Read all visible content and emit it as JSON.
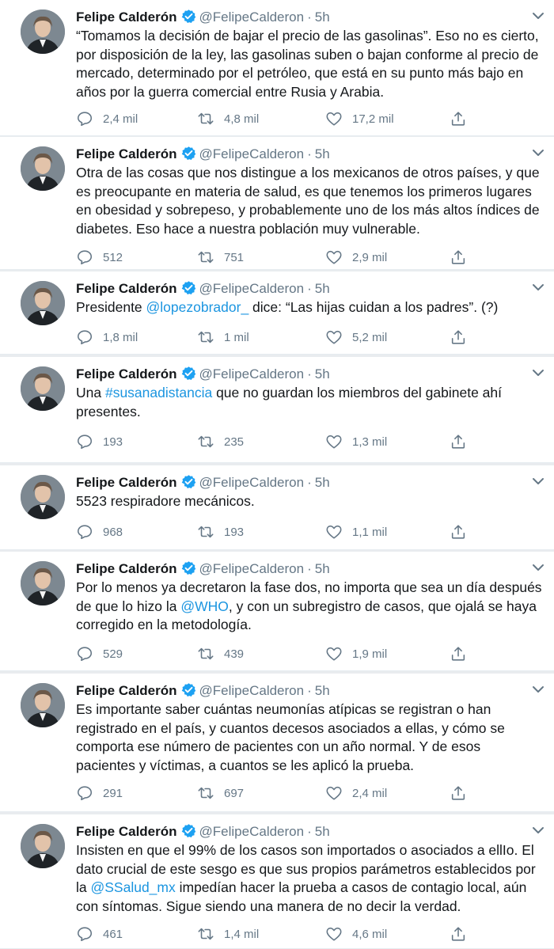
{
  "tweets": [
    {
      "name": "Felipe Calderón",
      "handle": "@FelipeCalderon",
      "time": "5h",
      "text": [
        {
          "t": "“Tomamos la decisión de bajar el precio de las gasolinas”. Eso no es cierto, por disposición de la ley, las gasolinas suben o bajan conforme al precio de mercado, determinado por el petróleo, que está en su punto más bajo en años por la guerra comercial entre Rusia y Arabia."
        }
      ],
      "replies": "2,4 mil",
      "retweets": "4,8 mil",
      "likes": "17,2 mil"
    },
    {
      "name": "Felipe Calderón",
      "handle": "@FelipeCalderon",
      "time": "5h",
      "text": [
        {
          "t": "Otra de las cosas que nos distingue a los mexicanos de otros países, y que es preocupante en materia de salud, es que tenemos los primeros lugares en obesidad y sobrepeso, y probablemente uno de los más altos índices de diabetes. Eso hace a nuestra población muy vulnerable."
        }
      ],
      "replies": "512",
      "retweets": "751",
      "likes": "2,9 mil"
    },
    {
      "name": "Felipe Calderón",
      "handle": "@FelipeCalderon",
      "time": "5h",
      "text": [
        {
          "t": "Presidente "
        },
        {
          "t": "@lopezobrador_",
          "link": true
        },
        {
          "t": " dice: “Las hijas cuidan a los padres”. (?)"
        }
      ],
      "replies": "1,8 mil",
      "retweets": "1 mil",
      "likes": "5,2 mil"
    },
    {
      "name": "Felipe Calderón",
      "handle": "@FelipeCalderon",
      "time": "5h",
      "text": [
        {
          "t": "Una "
        },
        {
          "t": "#susanadistancia",
          "link": true
        },
        {
          "t": " que no guardan los miembros del gabinete ahí presentes."
        }
      ],
      "replies": "193",
      "retweets": "235",
      "likes": "1,3 mil"
    },
    {
      "name": "Felipe Calderón",
      "handle": "@FelipeCalderon",
      "time": "5h",
      "text": [
        {
          "t": "5523 respiradore mecánicos."
        }
      ],
      "replies": "968",
      "retweets": "193",
      "likes": "1,1 mil"
    },
    {
      "name": "Felipe Calderón",
      "handle": "@FelipeCalderon",
      "time": "5h",
      "text": [
        {
          "t": "Por lo menos ya decretaron la fase dos, no importa que sea un día después de que lo hizo la "
        },
        {
          "t": "@WHO",
          "link": true
        },
        {
          "t": ", y con un subregistro de casos, que ojalá se haya corregido en la metodología."
        }
      ],
      "replies": "529",
      "retweets": "439",
      "likes": "1,9 mil"
    },
    {
      "name": "Felipe Calderón",
      "handle": "@FelipeCalderon",
      "time": "5h",
      "text": [
        {
          "t": "Es importante saber cuántas neumonías atípicas se registran o han registrado en el país, y cuantos decesos asociados a ellas, y cómo se comporta ese número de pacientes con un año normal. Y de esos pacientes y víctimas, a cuantos se les aplicó la prueba."
        }
      ],
      "replies": "291",
      "retweets": "697",
      "likes": "2,4 mil"
    },
    {
      "name": "Felipe Calderón",
      "handle": "@FelipeCalderon",
      "time": "5h",
      "text": [
        {
          "t": "Insisten en que el 99% de los casos son importados o asociados a ellIo. El dato crucial de este sesgo es que sus propios parámetros establecidos por la "
        },
        {
          "t": "@SSalud_mx",
          "link": true
        },
        {
          "t": " impedían hacer la prueba a casos de contagio local, aún con síntomas. Sigue siendo una manera de no decir la verdad."
        }
      ],
      "replies": "461",
      "retweets": "1,4 mil",
      "likes": "4,6 mil"
    }
  ],
  "colors": {
    "link": "#1b95e0",
    "verified": "#1da1f2",
    "muted": "#657786"
  },
  "icons": {
    "reply": "reply-icon",
    "retweet": "retweet-icon",
    "like": "like-icon",
    "share": "share-icon",
    "verified": "verified-badge-icon",
    "more": "chevron-down-icon"
  }
}
